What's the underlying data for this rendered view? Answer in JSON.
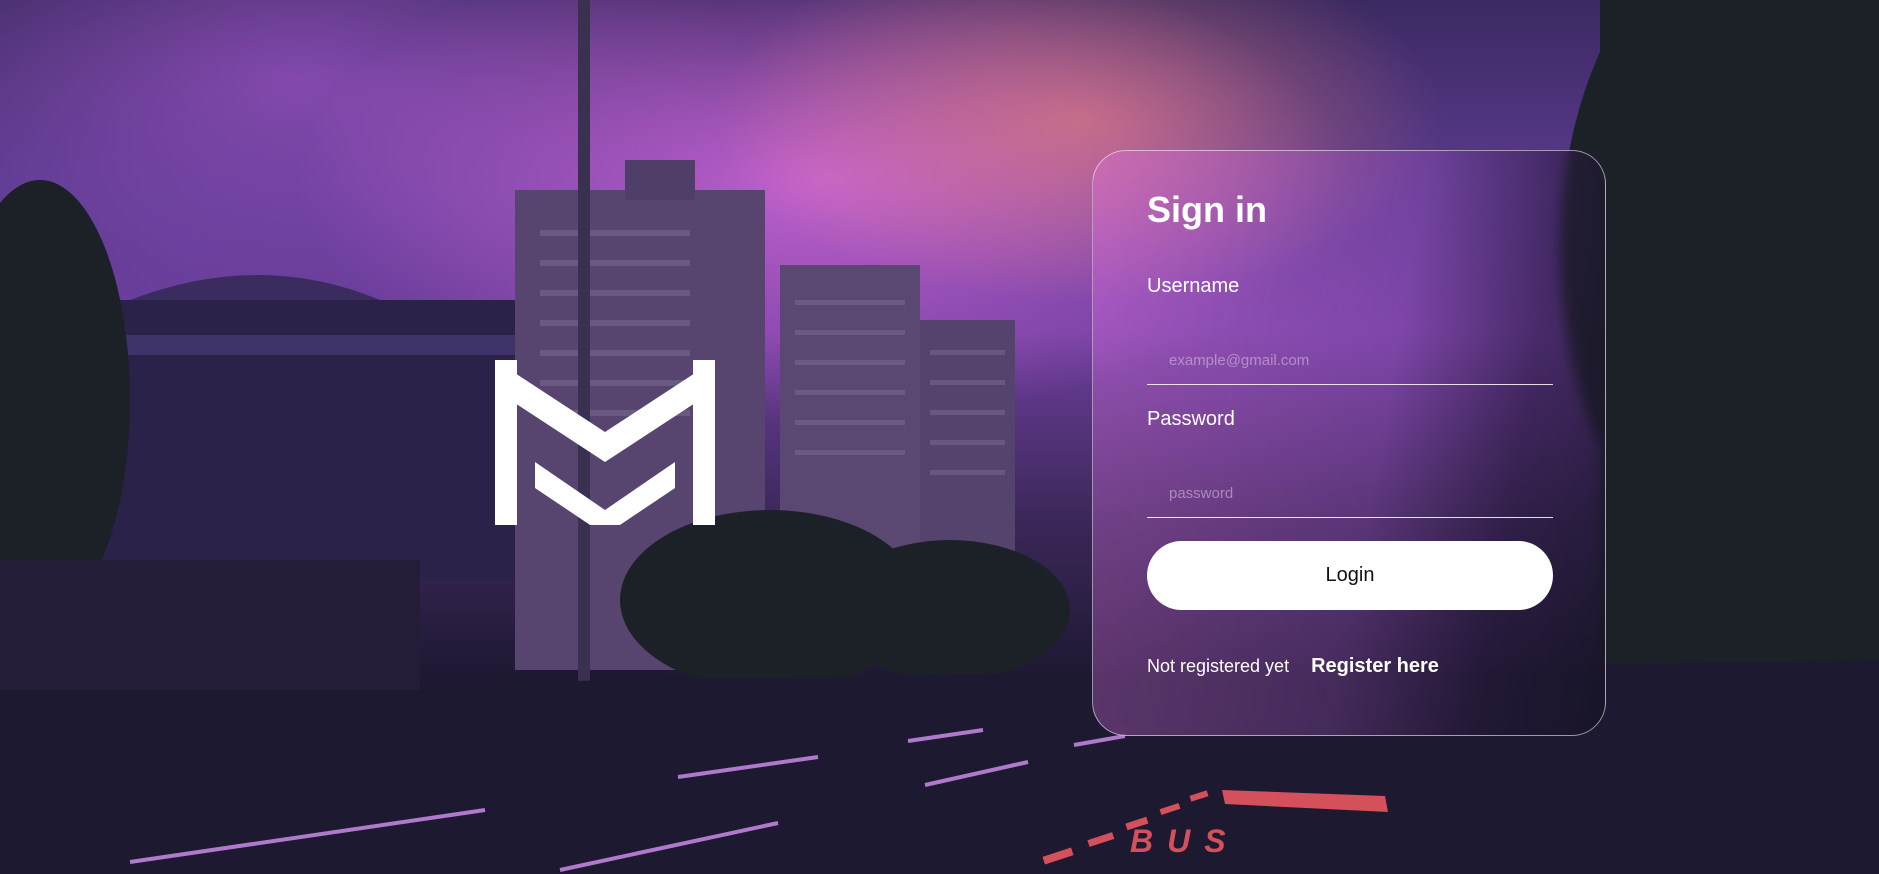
{
  "login_card": {
    "title": "Sign in",
    "username_label": "Username",
    "username_placeholder": "example@gmail.com",
    "password_label": "Password",
    "password_placeholder": "password",
    "login_button": "Login",
    "not_registered_text": "Not registered yet",
    "register_link": "Register here"
  },
  "background": {
    "road_marking_text": "BUS"
  },
  "colors": {
    "sky_purple": "#6f3f9f",
    "sky_pink": "#e66ee6",
    "sky_orange": "#ff8c78",
    "card_border": "#ffffff",
    "button_bg": "#ffffff",
    "button_text": "#111111",
    "bus_lane": "#d4505a"
  },
  "icons": {
    "logo": "double-chevron-m-logo"
  }
}
